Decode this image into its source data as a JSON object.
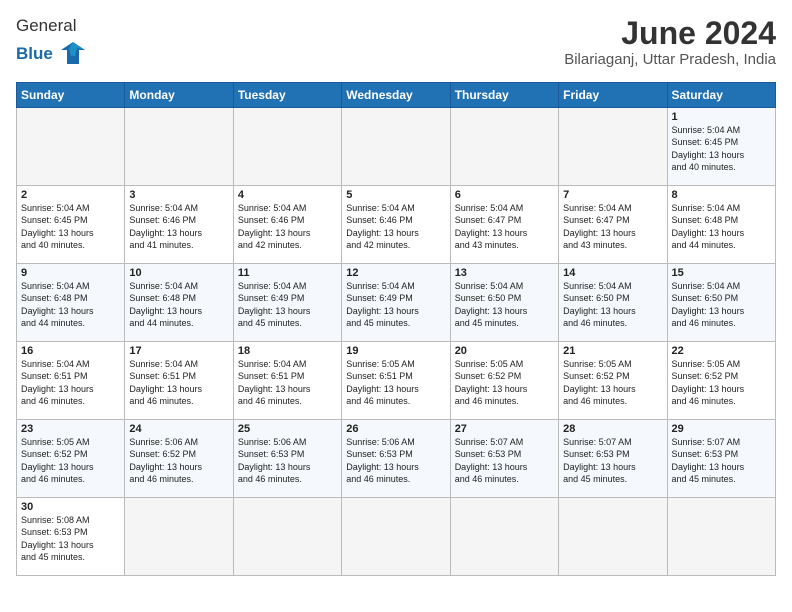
{
  "header": {
    "logo_general": "General",
    "logo_blue": "Blue",
    "month_title": "June 2024",
    "location": "Bilariaganj, Uttar Pradesh, India"
  },
  "weekdays": [
    "Sunday",
    "Monday",
    "Tuesday",
    "Wednesday",
    "Thursday",
    "Friday",
    "Saturday"
  ],
  "weeks": [
    [
      {
        "day": "",
        "info": ""
      },
      {
        "day": "",
        "info": ""
      },
      {
        "day": "",
        "info": ""
      },
      {
        "day": "",
        "info": ""
      },
      {
        "day": "",
        "info": ""
      },
      {
        "day": "",
        "info": ""
      },
      {
        "day": "1",
        "info": "Sunrise: 5:04 AM\nSunset: 6:45 PM\nDaylight: 13 hours\nand 40 minutes."
      }
    ],
    [
      {
        "day": "2",
        "info": "Sunrise: 5:04 AM\nSunset: 6:45 PM\nDaylight: 13 hours\nand 40 minutes."
      },
      {
        "day": "3",
        "info": "Sunrise: 5:04 AM\nSunset: 6:46 PM\nDaylight: 13 hours\nand 41 minutes."
      },
      {
        "day": "4",
        "info": "Sunrise: 5:04 AM\nSunset: 6:46 PM\nDaylight: 13 hours\nand 42 minutes."
      },
      {
        "day": "5",
        "info": "Sunrise: 5:04 AM\nSunset: 6:46 PM\nDaylight: 13 hours\nand 42 minutes."
      },
      {
        "day": "6",
        "info": "Sunrise: 5:04 AM\nSunset: 6:47 PM\nDaylight: 13 hours\nand 43 minutes."
      },
      {
        "day": "7",
        "info": "Sunrise: 5:04 AM\nSunset: 6:47 PM\nDaylight: 13 hours\nand 43 minutes."
      },
      {
        "day": "8",
        "info": "Sunrise: 5:04 AM\nSunset: 6:48 PM\nDaylight: 13 hours\nand 44 minutes."
      }
    ],
    [
      {
        "day": "9",
        "info": "Sunrise: 5:04 AM\nSunset: 6:48 PM\nDaylight: 13 hours\nand 44 minutes."
      },
      {
        "day": "10",
        "info": "Sunrise: 5:04 AM\nSunset: 6:48 PM\nDaylight: 13 hours\nand 44 minutes."
      },
      {
        "day": "11",
        "info": "Sunrise: 5:04 AM\nSunset: 6:49 PM\nDaylight: 13 hours\nand 45 minutes."
      },
      {
        "day": "12",
        "info": "Sunrise: 5:04 AM\nSunset: 6:49 PM\nDaylight: 13 hours\nand 45 minutes."
      },
      {
        "day": "13",
        "info": "Sunrise: 5:04 AM\nSunset: 6:50 PM\nDaylight: 13 hours\nand 45 minutes."
      },
      {
        "day": "14",
        "info": "Sunrise: 5:04 AM\nSunset: 6:50 PM\nDaylight: 13 hours\nand 46 minutes."
      },
      {
        "day": "15",
        "info": "Sunrise: 5:04 AM\nSunset: 6:50 PM\nDaylight: 13 hours\nand 46 minutes."
      }
    ],
    [
      {
        "day": "16",
        "info": "Sunrise: 5:04 AM\nSunset: 6:51 PM\nDaylight: 13 hours\nand 46 minutes."
      },
      {
        "day": "17",
        "info": "Sunrise: 5:04 AM\nSunset: 6:51 PM\nDaylight: 13 hours\nand 46 minutes."
      },
      {
        "day": "18",
        "info": "Sunrise: 5:04 AM\nSunset: 6:51 PM\nDaylight: 13 hours\nand 46 minutes."
      },
      {
        "day": "19",
        "info": "Sunrise: 5:05 AM\nSunset: 6:51 PM\nDaylight: 13 hours\nand 46 minutes."
      },
      {
        "day": "20",
        "info": "Sunrise: 5:05 AM\nSunset: 6:52 PM\nDaylight: 13 hours\nand 46 minutes."
      },
      {
        "day": "21",
        "info": "Sunrise: 5:05 AM\nSunset: 6:52 PM\nDaylight: 13 hours\nand 46 minutes."
      },
      {
        "day": "22",
        "info": "Sunrise: 5:05 AM\nSunset: 6:52 PM\nDaylight: 13 hours\nand 46 minutes."
      }
    ],
    [
      {
        "day": "23",
        "info": "Sunrise: 5:05 AM\nSunset: 6:52 PM\nDaylight: 13 hours\nand 46 minutes."
      },
      {
        "day": "24",
        "info": "Sunrise: 5:06 AM\nSunset: 6:52 PM\nDaylight: 13 hours\nand 46 minutes."
      },
      {
        "day": "25",
        "info": "Sunrise: 5:06 AM\nSunset: 6:53 PM\nDaylight: 13 hours\nand 46 minutes."
      },
      {
        "day": "26",
        "info": "Sunrise: 5:06 AM\nSunset: 6:53 PM\nDaylight: 13 hours\nand 46 minutes."
      },
      {
        "day": "27",
        "info": "Sunrise: 5:07 AM\nSunset: 6:53 PM\nDaylight: 13 hours\nand 46 minutes."
      },
      {
        "day": "28",
        "info": "Sunrise: 5:07 AM\nSunset: 6:53 PM\nDaylight: 13 hours\nand 45 minutes."
      },
      {
        "day": "29",
        "info": "Sunrise: 5:07 AM\nSunset: 6:53 PM\nDaylight: 13 hours\nand 45 minutes."
      }
    ],
    [
      {
        "day": "30",
        "info": "Sunrise: 5:08 AM\nSunset: 6:53 PM\nDaylight: 13 hours\nand 45 minutes."
      },
      {
        "day": "",
        "info": ""
      },
      {
        "day": "",
        "info": ""
      },
      {
        "day": "",
        "info": ""
      },
      {
        "day": "",
        "info": ""
      },
      {
        "day": "",
        "info": ""
      },
      {
        "day": "",
        "info": ""
      }
    ]
  ]
}
